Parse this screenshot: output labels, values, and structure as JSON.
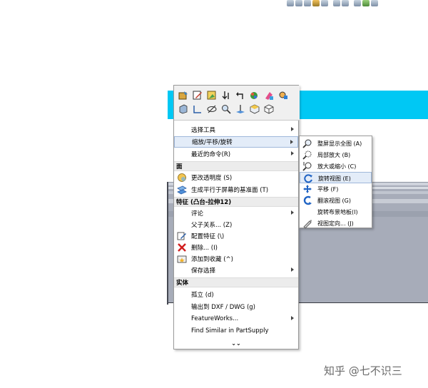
{
  "top_toolbar": {
    "icons": [
      "zoom-fit-icon",
      "zoom-area-icon",
      "previous-view-icon",
      "section-view-icon",
      "dynamic-annotation-icon",
      "view-orientation-icon",
      "display-style-icon",
      "hide-show-icon",
      "appearance-icon",
      "scene-icon"
    ]
  },
  "context_menu": {
    "toolbar_icons_row1": [
      "rebuild-icon",
      "edit-sketch-icon",
      "edit-feature-icon",
      "normal-to-icon",
      "undo-icon",
      "appearance-icon",
      "edit-color-icon",
      "zoom-selection-icon"
    ],
    "toolbar_icons_row2": [
      "section-view-icon",
      "sketch-icon",
      "hide-icon",
      "zoom-to-fit-icon",
      "reference-plane-icon",
      "isometric-view-icon",
      "standard-views-icon"
    ],
    "items_general": [
      {
        "label": "选择工具",
        "has_submenu": true
      },
      {
        "label": "缩放/平移/旋转",
        "has_submenu": true
      },
      {
        "label": "最近的命令(R)",
        "has_submenu": true
      }
    ],
    "section_face": "面",
    "items_face": [
      {
        "label": "更改透明度 (S)",
        "icon": "transparency-icon"
      },
      {
        "label": "生成平行于屏幕的基准面 (T)",
        "icon": "plane-icon"
      }
    ],
    "section_feature": "特征 (凸台-拉伸12)",
    "items_feature": [
      {
        "label": "评论",
        "has_submenu": true
      },
      {
        "label": "父子关系... (Z)"
      },
      {
        "label": "配置特征 (\\)",
        "icon": "configure-feature-icon"
      },
      {
        "label": "删除... (I)",
        "icon": "delete-icon"
      },
      {
        "label": "添加到收藏 (^)",
        "icon": "add-favorite-icon"
      },
      {
        "label": "保存选择",
        "has_submenu": true
      }
    ],
    "section_body": "实体",
    "items_body": [
      {
        "label": "孤立 (d)"
      },
      {
        "label": "输出到 DXF / DWG (g)"
      },
      {
        "label": "FeatureWorks...",
        "has_submenu": true
      },
      {
        "label": "Find Similar in PartSupply"
      }
    ],
    "expand_glyph": "⌄⌄"
  },
  "submenu": {
    "items": [
      {
        "label": "整屏显示全图 (A)",
        "icon": "zoom-to-fit-icon"
      },
      {
        "label": "局部放大 (B)",
        "icon": "zoom-to-area-icon"
      },
      {
        "label": "放大或缩小 (C)",
        "icon": "zoom-in-out-icon"
      },
      {
        "label": "旋转视图 (E)",
        "icon": "rotate-view-icon"
      },
      {
        "label": "平移 (F)",
        "icon": "pan-icon"
      },
      {
        "label": "翻滚视图 (G)",
        "icon": "roll-view-icon"
      },
      {
        "label": "旋转布景地板(I)",
        "icon": ""
      },
      {
        "label": "视图定向... (J)",
        "icon": "view-orientation-icon"
      }
    ]
  },
  "colors": {
    "viewport_cyan": "#00c8f4",
    "model_gray": "#a7acb9",
    "highlight": "#e3ecf8"
  },
  "watermark": "知乎 @七不识三"
}
